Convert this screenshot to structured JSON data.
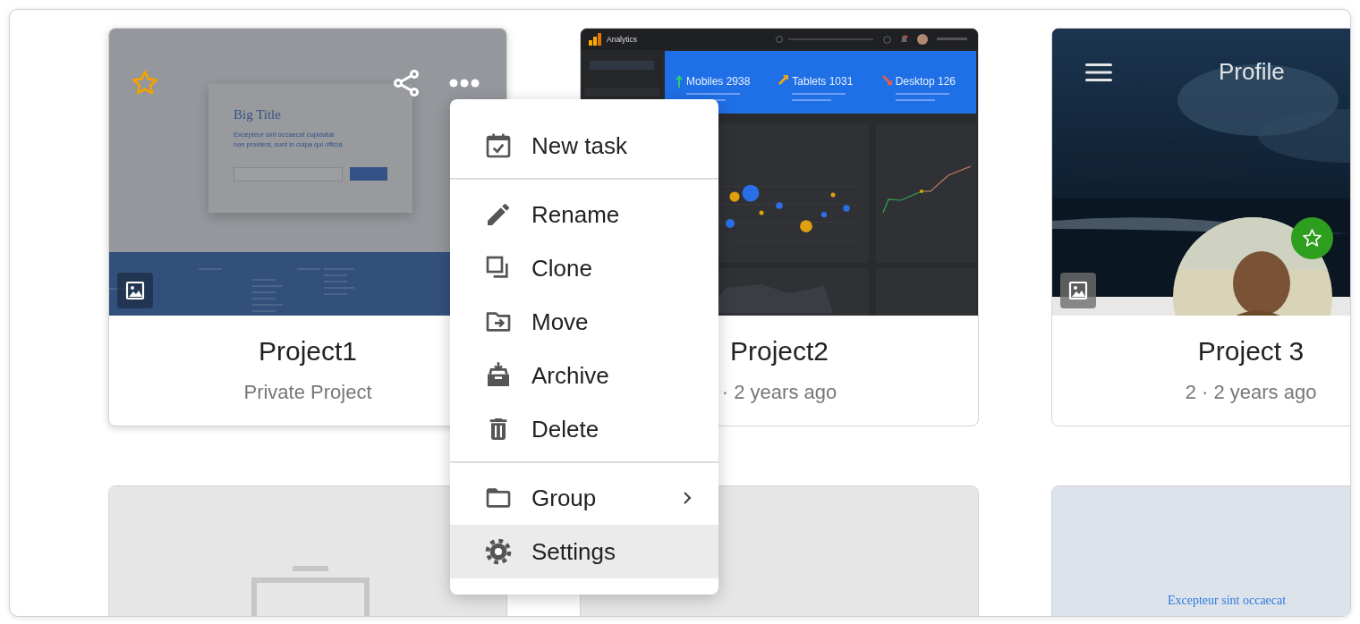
{
  "projects": [
    {
      "title": "Project1",
      "subtitle": "Private Project",
      "hovered": true,
      "favorite": false,
      "image_badge": true,
      "thumbnail": {
        "kind": "landing",
        "heading": "Big Title",
        "text": "Excepteur sint occaecat cupidatat non proident, sunt in culpa qui officia"
      }
    },
    {
      "title": "Project2",
      "subtitle": "· 2 years ago",
      "hovered": false,
      "thumbnail": {
        "kind": "dashboard",
        "app_name": "Analytics",
        "stats": [
          {
            "kind": "up",
            "label": "Mobiles 2938"
          },
          {
            "kind": "flat",
            "label": "Tablets 1031"
          },
          {
            "kind": "down",
            "label": "Desktop 126"
          }
        ]
      }
    },
    {
      "title": "Project 3",
      "subtitle": "2 · 2 years ago",
      "hovered": false,
      "image_badge": true,
      "thumbnail": {
        "kind": "profile",
        "heading": "Profile"
      }
    },
    {
      "hovered": false,
      "thumbnail": {
        "kind": "empty"
      }
    },
    {
      "hovered": false,
      "thumbnail": {
        "kind": "blank"
      }
    },
    {
      "hovered": false,
      "thumbnail": {
        "kind": "text",
        "text": "Excepteur sint occaecat"
      }
    }
  ],
  "menu": {
    "sections": [
      [
        {
          "kind": "task",
          "label": "New task",
          "submenu": false,
          "selected": false
        }
      ],
      [
        {
          "kind": "rename",
          "label": "Rename",
          "submenu": false,
          "selected": false
        },
        {
          "kind": "clone",
          "label": "Clone",
          "submenu": false,
          "selected": false
        },
        {
          "kind": "move",
          "label": "Move",
          "submenu": false,
          "selected": false
        },
        {
          "kind": "archive",
          "label": "Archive",
          "submenu": false,
          "selected": false
        },
        {
          "kind": "delete",
          "label": "Delete",
          "submenu": false,
          "selected": false
        }
      ],
      [
        {
          "kind": "group",
          "label": "Group",
          "submenu": true,
          "selected": false
        },
        {
          "kind": "settings",
          "label": "Settings",
          "submenu": false,
          "selected": true
        }
      ]
    ]
  }
}
